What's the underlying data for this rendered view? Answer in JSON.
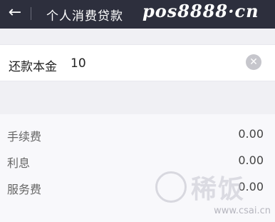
{
  "header": {
    "back_icon": "arrow-left-icon",
    "title": "个人消费贷款",
    "watermark": "pos8888·cn"
  },
  "repayment": {
    "label": "还款本金",
    "value": "10",
    "clear_icon": "clear-circle-icon"
  },
  "fees": [
    {
      "label": "手续费",
      "value": "0.00"
    },
    {
      "label": "利息",
      "value": "0.00"
    },
    {
      "label": "服务费",
      "value": "0.00"
    }
  ],
  "watermark_bottom": {
    "brand": "稀饭",
    "site": "www.csai.cn"
  }
}
